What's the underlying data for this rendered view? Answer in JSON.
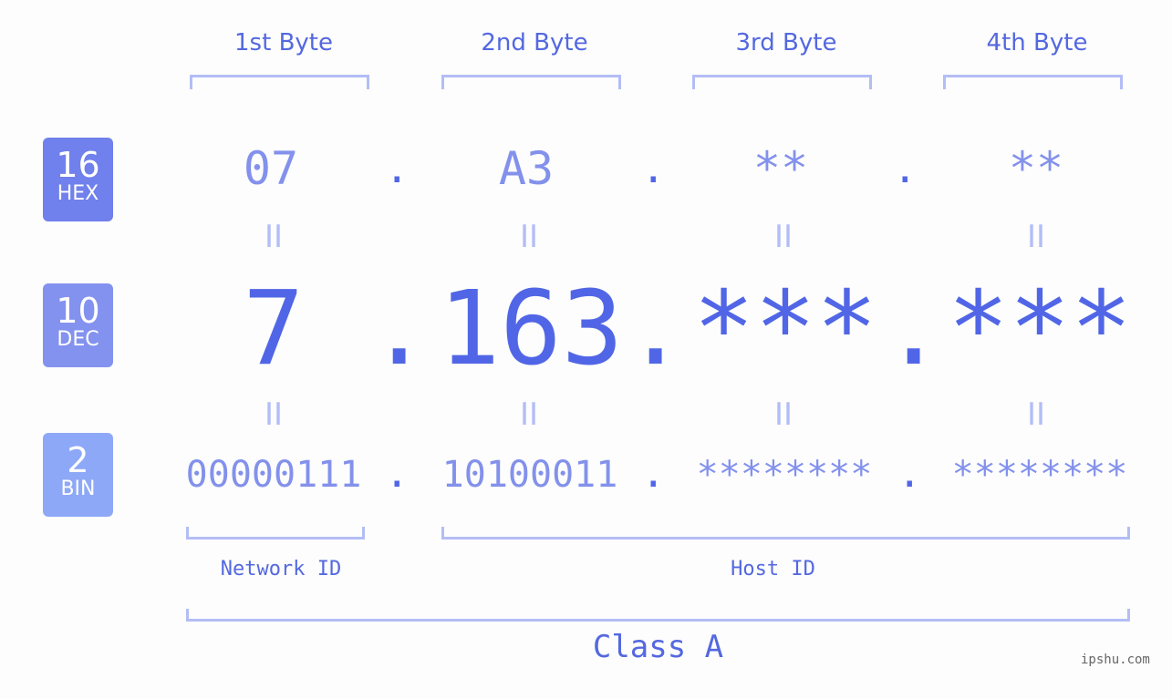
{
  "badges": [
    {
      "base": "16",
      "label": "HEX",
      "color": "#7080ec"
    },
    {
      "base": "10",
      "label": "DEC",
      "color": "#8392ef"
    },
    {
      "base": "2",
      "label": "BIN",
      "color": "#8ea8f8"
    }
  ],
  "byte_headers": [
    "1st Byte",
    "2nd Byte",
    "3rd Byte",
    "4th Byte"
  ],
  "hex": [
    "07",
    "A3",
    "**",
    "**"
  ],
  "dec": [
    "7",
    "163",
    "***",
    "***"
  ],
  "bin": [
    "00000111",
    "10100011",
    "********",
    "********"
  ],
  "separator": ".",
  "equals": "II",
  "network_id_label": "Network ID",
  "host_id_label": "Host ID",
  "class_label": "Class A",
  "watermark": "ipshu.com",
  "colors": {
    "accent": "#5166e6",
    "light": "#8391ec",
    "bracket": "#b3bdf6"
  }
}
